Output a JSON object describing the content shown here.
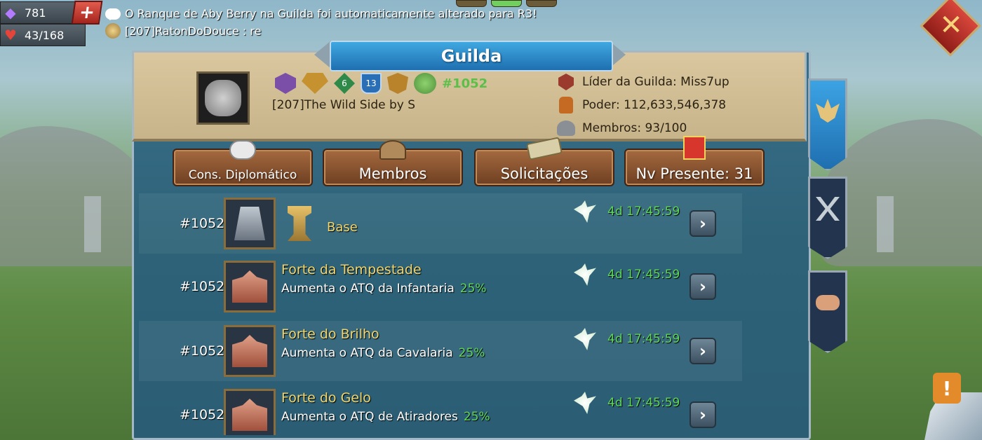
{
  "resources": {
    "gems": "781",
    "add_symbol": "+",
    "health": "43/168"
  },
  "chat": {
    "system_message": "O Ranque de Aby Berry na Guilda foi automaticamente alterado para R3!",
    "player_message": "[207]RatonDoDouce : re"
  },
  "close_symbol": "✕",
  "title": "Guilda",
  "guild": {
    "badge_level_1": "6",
    "badge_level_2": "13",
    "rank": "#1052",
    "name": "[207]The Wild Side by S",
    "leader": "Líder da Guilda: Miss7up",
    "power": "Poder: 112,633,546,378",
    "members": "Membros: 93/100"
  },
  "actions": {
    "diplomatic": "Cons. Diplomático",
    "members": "Membros",
    "requests": "Solicitações",
    "gift_level": "Nv Presente: 31"
  },
  "arrow_symbol": "›",
  "rows": [
    {
      "rank": "#1052",
      "title": "Base",
      "description": "",
      "bonus": "",
      "timer": "4d 17:45:59"
    },
    {
      "rank": "#1052",
      "title": "Forte da Tempestade",
      "description": "Aumenta o ATQ da Infantaria",
      "bonus": "25%",
      "timer": "4d 17:45:59"
    },
    {
      "rank": "#1052",
      "title": "Forte do Brilho",
      "description": "Aumenta o ATQ da Cavalaria",
      "bonus": "25%",
      "timer": "4d 17:45:59"
    },
    {
      "rank": "#1052",
      "title": "Forte do Gelo",
      "description": "Aumenta o ATQ de Atiradores",
      "bonus": "25%",
      "timer": "4d 17:45:59"
    }
  ],
  "alert_symbol": "!",
  "colors": {
    "panel_blue": "#2d6278",
    "header_tan": "#dac79f",
    "button_brown": "#8a5533",
    "timer_green": "#5fd55a",
    "title_gold": "#f1d66e",
    "close_red": "#c0392b"
  }
}
